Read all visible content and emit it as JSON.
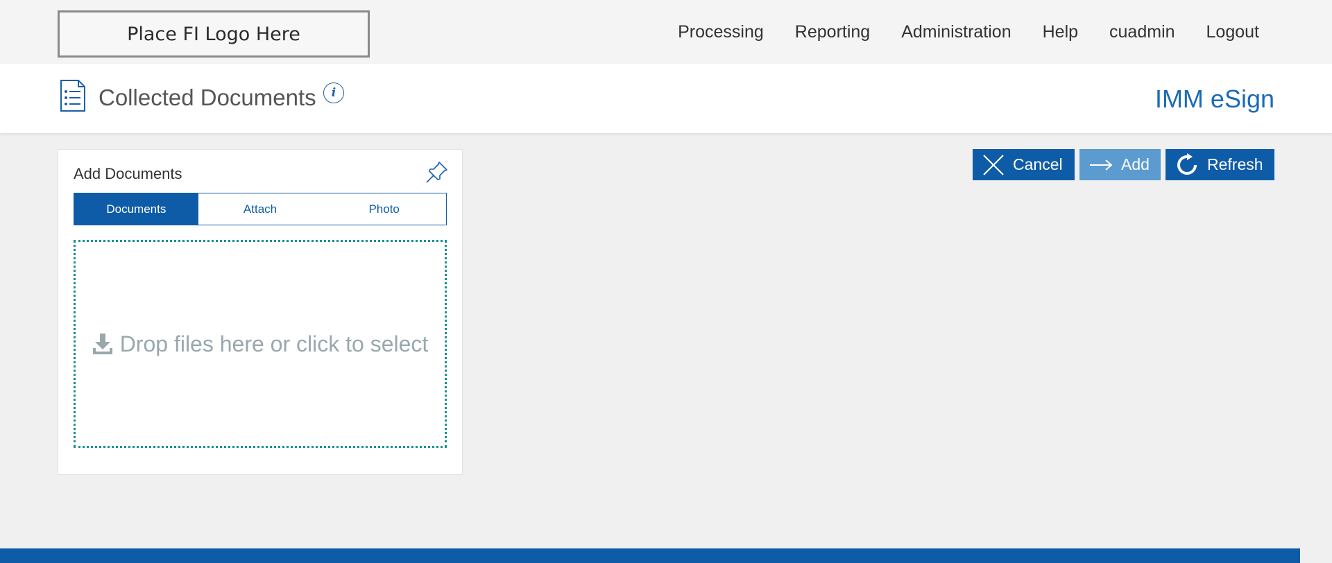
{
  "header": {
    "logo_text": "Place FI Logo Here",
    "nav": [
      "Processing",
      "Reporting",
      "Administration",
      "Help",
      "cuadmin",
      "Logout"
    ]
  },
  "title_bar": {
    "page_title": "Collected Documents",
    "info_icon_glyph": "i",
    "app_name": "IMM eSign"
  },
  "card": {
    "title": "Add Documents",
    "tabs": [
      "Documents",
      "Attach",
      "Photo"
    ],
    "active_tab": "Documents",
    "dropzone_text": "Drop files here or click to select"
  },
  "actions": {
    "cancel_label": "Cancel",
    "add_label": "Add",
    "refresh_label": "Refresh"
  },
  "icons": {
    "document_list": "document-list-icon",
    "info": "info-icon",
    "pin": "pin-icon",
    "download": "download-icon",
    "close": "close-icon",
    "arrow_right": "arrow-right-icon",
    "refresh": "refresh-icon"
  },
  "colors": {
    "primary": "#0e5ca8",
    "primary_light": "#5b9bd0",
    "app_name": "#1a6bb5",
    "dropzone_border": "#1b8f8f",
    "dropzone_text": "#98a8ad"
  }
}
